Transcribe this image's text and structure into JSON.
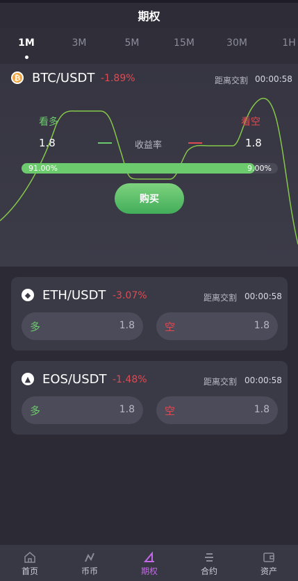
{
  "header": {
    "title": "期权"
  },
  "tabs": [
    {
      "label": "1M",
      "active": true
    },
    {
      "label": "3M",
      "active": false
    },
    {
      "label": "5M",
      "active": false
    },
    {
      "label": "15M",
      "active": false
    },
    {
      "label": "30M",
      "active": false
    },
    {
      "label": "1H",
      "active": false
    }
  ],
  "hero": {
    "icon": "btc-icon",
    "pair": "BTC/USDT",
    "change": "-1.89%",
    "countdown_label": "距离交割",
    "countdown": "00:00:58",
    "up_label": "看多",
    "down_label": "看空",
    "up_rate": "1.8",
    "down_rate": "1.8",
    "rate_label": "收益率",
    "up_percent_text": "91.00%",
    "down_percent_text": "9.00%",
    "up_fraction": 0.91,
    "buy_label": "购买"
  },
  "cards": [
    {
      "icon": "eth-icon",
      "pair": "ETH/USDT",
      "change": "-3.07%",
      "countdown_label": "距离交割",
      "countdown": "00:00:58",
      "long_label": "多",
      "long_rate": "1.8",
      "short_label": "空",
      "short_rate": "1.8"
    },
    {
      "icon": "eos-icon",
      "pair": "EOS/USDT",
      "change": "-1.48%",
      "countdown_label": "距离交割",
      "countdown": "00:00:58",
      "long_label": "多",
      "long_rate": "1.8",
      "short_label": "空",
      "short_rate": "1.8"
    }
  ],
  "tabbar": [
    {
      "label": "首页",
      "icon": "home-icon",
      "active": false
    },
    {
      "label": "币币",
      "icon": "coin-trade-icon",
      "active": false
    },
    {
      "label": "期权",
      "icon": "options-icon",
      "active": true
    },
    {
      "label": "合约",
      "icon": "contract-icon",
      "active": false
    },
    {
      "label": "资产",
      "icon": "wallet-icon",
      "active": false
    }
  ],
  "colors": {
    "up": "#6ccb6c",
    "down": "#e04a52",
    "accent": "#c468e8",
    "background": "#2b2a35"
  }
}
